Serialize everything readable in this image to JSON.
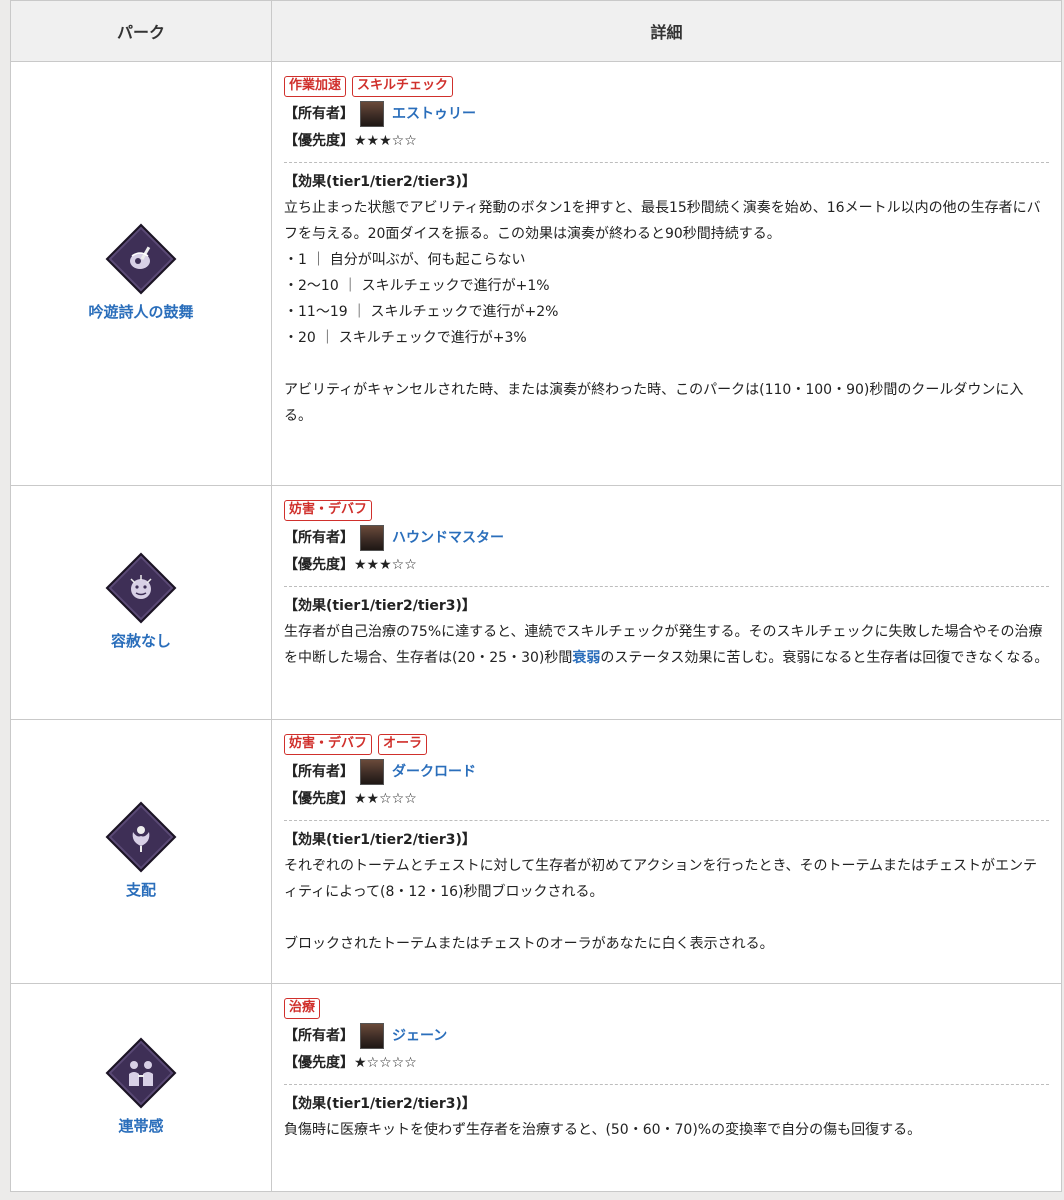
{
  "header": {
    "perk": "パーク",
    "detail": "詳細"
  },
  "labels": {
    "owner": "【所有者】",
    "priority": "【優先度】"
  },
  "perks": [
    {
      "name": "吟遊詩人の鼓舞",
      "icon": "bard-perk-icon",
      "tags": [
        "作業加速",
        "スキルチェック"
      ],
      "owner": "エストゥリー",
      "priority": "★★★☆☆",
      "effect_title": "【効果(tier1/tier2/tier3)】",
      "lines": [
        "立ち止まった状態でアビリティ発動のボタン1を押すと、最長15秒間続く演奏を始め、16メートル以内の他の生存者にバフを与える。20面ダイスを振る。この効果は演奏が終わると90秒間持続する。",
        "・1 ｜ 自分が叫ぶが、何も起こらない",
        "・2〜10 ｜ スキルチェックで進行が+1%",
        "・11〜19 ｜ スキルチェックで進行が+2%",
        "・20 ｜ スキルチェックで進行が+3%",
        "",
        "アビリティがキャンセルされた時、または演奏が終わった時、このパークは(110・100・90)秒間のクールダウンに入る。"
      ]
    },
    {
      "name": "容赦なし",
      "icon": "no-quarter-perk-icon",
      "tags": [
        "妨害・デバフ"
      ],
      "owner": "ハウンドマスター",
      "priority": "★★★☆☆",
      "effect_title": "【効果(tier1/tier2/tier3)】",
      "line_before": "生存者が自己治療の75%に達すると、連続でスキルチェックが発生する。そのスキルチェックに失敗した場合やその治療を中断した場合、生存者は(20・25・30)秒間",
      "link": "衰弱",
      "line_after": "のステータス効果に苦しむ。衰弱になると生存者は回復できなくなる。"
    },
    {
      "name": "支配",
      "icon": "dominance-perk-icon",
      "tags": [
        "妨害・デバフ",
        "オーラ"
      ],
      "owner": "ダークロード",
      "priority": "★★☆☆☆",
      "effect_title": "【効果(tier1/tier2/tier3)】",
      "lines": [
        "それぞれのトーテムとチェストに対して生存者が初めてアクションを行ったとき、そのトーテムまたはチェストがエンティティによって(8・12・16)秒間ブロックされる。",
        "",
        "ブロックされたトーテムまたはチェストのオーラがあなたに白く表示される。"
      ]
    },
    {
      "name": "連帯感",
      "icon": "camaraderie-perk-icon",
      "tags": [
        "治療"
      ],
      "owner": "ジェーン",
      "priority": "★☆☆☆☆",
      "effect_title": "【効果(tier1/tier2/tier3)】",
      "lines": [
        "負傷時に医療キットを使わず生存者を治療すると、(50・60・70)%の変換率で自分の傷も回復する。"
      ]
    }
  ]
}
